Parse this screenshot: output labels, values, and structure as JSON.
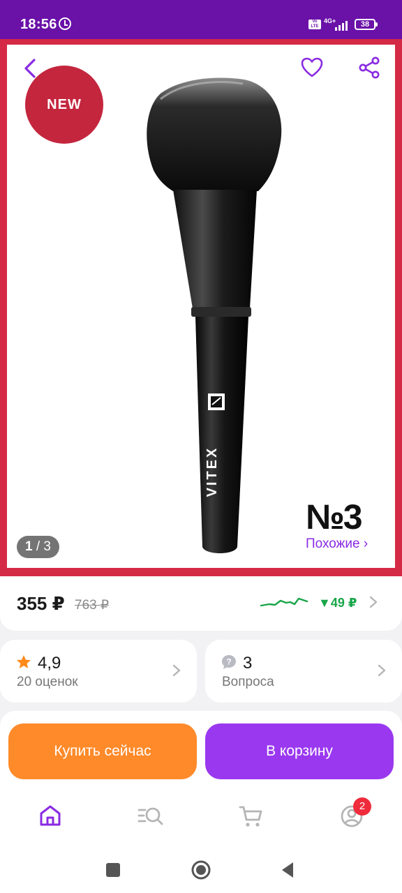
{
  "status_bar": {
    "time": "18:56",
    "volte": "Vo LTE",
    "network": "4G+",
    "battery": "38"
  },
  "gallery": {
    "badge": "NEW",
    "brand": "VITEX",
    "number_mark": "№3",
    "counter_current": "1",
    "counter_total": "3",
    "similar_label": "Похожие ›"
  },
  "price": {
    "current": "355 ₽",
    "old": "763 ₽",
    "drop": "▼49 ₽"
  },
  "rating": {
    "value": "4,9",
    "count_label": "20 оценок"
  },
  "questions": {
    "count": "3",
    "label": "Вопроса"
  },
  "actions": {
    "buy_now": "Купить сейчас",
    "add_to_cart": "В корзину"
  },
  "bottom_nav": {
    "profile_badge": "2"
  },
  "colors": {
    "brand_purple": "#6a11a8",
    "accent_violet": "#9a38ef",
    "buy_orange": "#ff8a2a",
    "price_drop_green": "#19a64a",
    "frame_red": "#d42a45"
  }
}
